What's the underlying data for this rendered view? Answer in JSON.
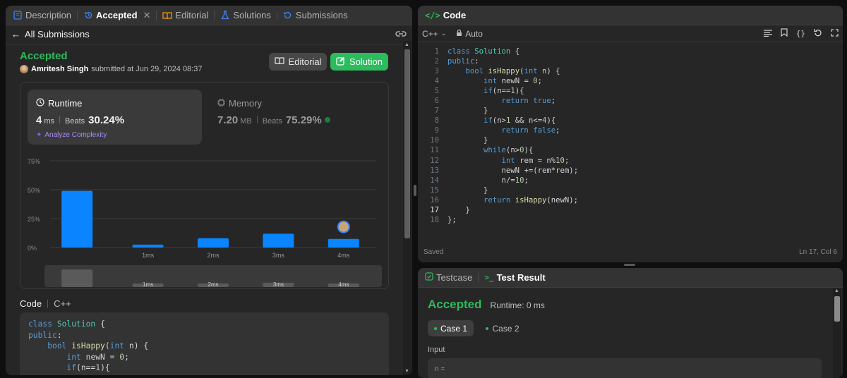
{
  "left_tabs": [
    {
      "label": "Description"
    },
    {
      "label": "Accepted"
    },
    {
      "label": "Editorial"
    },
    {
      "label": "Solutions"
    },
    {
      "label": "Submissions"
    }
  ],
  "back_label": "All Submissions",
  "status": "Accepted",
  "user": {
    "name": "Amritesh Singh",
    "submitted": "submitted at Jun 29, 2024 08:37"
  },
  "buttons": {
    "editorial": "Editorial",
    "solution": "Solution"
  },
  "runtime": {
    "title": "Runtime",
    "value": "4",
    "unit": "ms",
    "beats_label": "Beats",
    "beats": "30.24%",
    "analyze": "Analyze Complexity"
  },
  "memory": {
    "title": "Memory",
    "value": "7.20",
    "unit": "MB",
    "beats_label": "Beats",
    "beats": "75.29%"
  },
  "chart_data": {
    "type": "bar",
    "y_ticks": [
      "75%",
      "50%",
      "25%",
      "0%"
    ],
    "ylim": [
      0,
      75
    ],
    "categories": [
      "",
      "1ms",
      "2ms",
      "3ms",
      "4ms"
    ],
    "values": [
      49,
      2.5,
      8,
      12,
      7.5
    ],
    "highlight_index": 4,
    "colors": {
      "bar": "#0a84ff",
      "grid": "#3e3e3e",
      "mini_bar": "#5a5a5a"
    }
  },
  "code_section": {
    "label": "Code",
    "lang": "C++"
  },
  "preview_lines": [
    "class Solution {",
    "public:",
    "    bool isHappy(int n) {",
    "        int newN = 0;",
    "        if(n==1){"
  ],
  "editor": {
    "title": "Code",
    "lang": "C++",
    "auto": "Auto",
    "status": "Saved",
    "position": "Ln 17, Col 6",
    "lines": [
      "class Solution {",
      "public:",
      "    bool isHappy(int n) {",
      "        int newN = 0;",
      "        if(n==1){",
      "            return true;",
      "        }",
      "        if(n>1 && n<=4){",
      "            return false;",
      "        }",
      "        while(n>0){",
      "            int rem = n%10;",
      "            newN +=(rem*rem);",
      "            n/=10;",
      "        }",
      "        return isHappy(newN);",
      "    }",
      "};"
    ]
  },
  "test": {
    "tab1": "Testcase",
    "tab2": "Test Result",
    "status": "Accepted",
    "runtime": "Runtime: 0 ms",
    "case1": "Case 1",
    "case2": "Case 2",
    "input_label": "Input",
    "input_var": "n ="
  }
}
